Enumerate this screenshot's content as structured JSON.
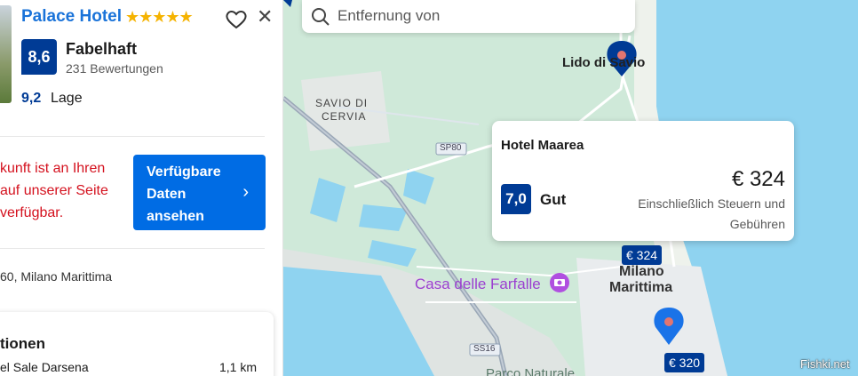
{
  "hotel": {
    "name": "Palace Hotel",
    "stars": "★★★★★",
    "score": "8,6",
    "score_label": "Fabelhaft",
    "reviews": "231 Bewertungen",
    "location_score": "9,2",
    "location_label": "Lage"
  },
  "availability": {
    "message_lines": [
      "kunft ist an Ihren",
      "auf unserer Seite",
      "verfügbar."
    ],
    "button_lines": [
      "Verfügbare",
      "Daten",
      "ansehen"
    ]
  },
  "address": "60, Milano Marittima",
  "nearby": {
    "title": "tionen",
    "item_name": "el Sale Darsena",
    "item_distance": "1,1 km"
  },
  "search": {
    "placeholder": "Entfernung von"
  },
  "map": {
    "labels": {
      "lido": "Lido di Savio",
      "savio_line1": "SAVIO DI",
      "savio_line2": "CERVIA",
      "sp80": "SP80",
      "ss16": "SS16",
      "casa": "Casa delle Farfalle",
      "milano_line1": "Milano",
      "milano_line2": "Marittima",
      "parco": "Parco Naturale"
    },
    "price_tags": [
      "€ 324",
      "€ 320"
    ],
    "colors": {
      "sea": "#8fd3f0",
      "land": "#cfe9d9",
      "marker": "#003b95",
      "active_marker": "#1a73e8"
    }
  },
  "popup": {
    "name": "Hotel Maarea",
    "score": "7,0",
    "score_label": "Gut",
    "price": "€ 324",
    "tax_line1": "Einschließlich Steuern und",
    "tax_line2": "Gebühren"
  },
  "watermark": "Fishki.net"
}
